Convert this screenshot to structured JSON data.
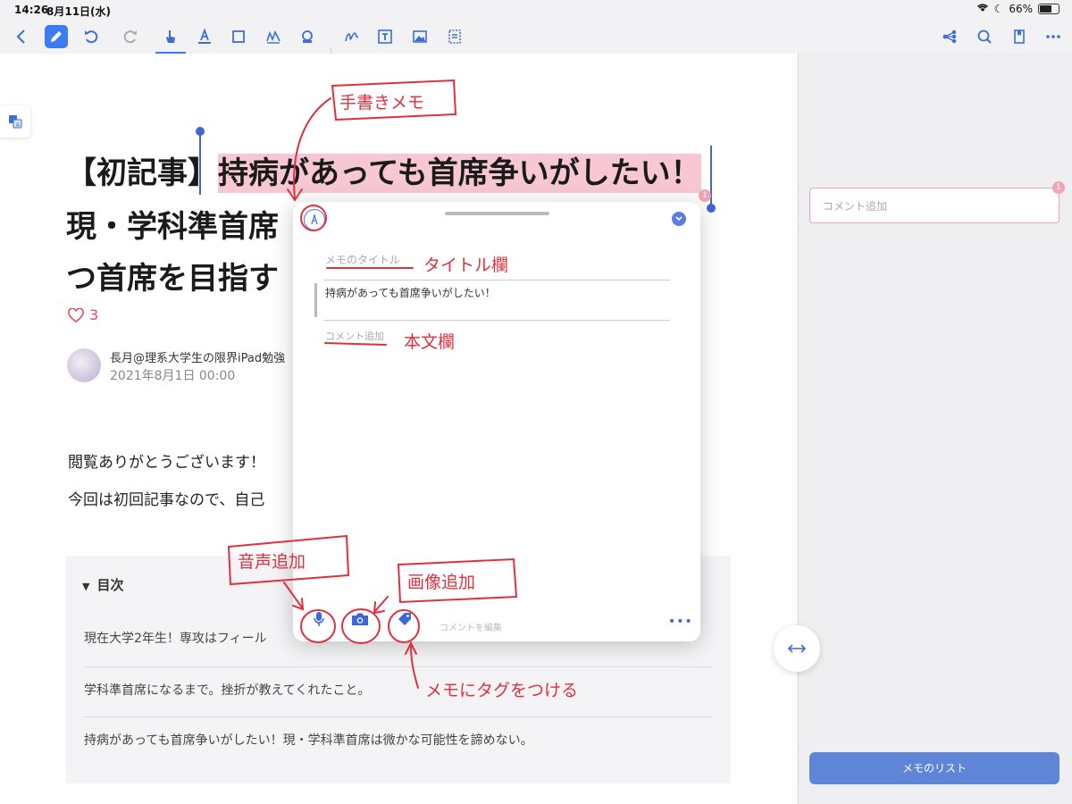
{
  "status": {
    "time": "14:26",
    "date": "8月11日(水)",
    "battery": "66%",
    "battery_level": 0.66
  },
  "toolbar": {
    "left": [
      "back-icon",
      "pen-icon",
      "undo-icon",
      "redo-icon",
      "hand-icon",
      "text-highlight-icon",
      "rect-select-icon",
      "sign-icon",
      "stamp-icon",
      "freehand-icon",
      "textbox-icon",
      "image-icon",
      "scan-icon"
    ],
    "right": [
      "share-icon",
      "search-icon",
      "bookmark-icon",
      "more-icon"
    ],
    "active": "pen-icon",
    "selected": "hand-icon"
  },
  "article": {
    "title_prefix": "【初記事】",
    "title_highlight": "持病があっても首席争いがしたい！",
    "title_line2": "現・学科準首席",
    "title_line3": "つ首席を目指す",
    "likes": "3",
    "author": "長月@理系大学生の限界iPad勉強",
    "date": "2021年8月1日 00:00",
    "para1": "閲覧ありがとうございます！",
    "para2": "今回は初回記事なので、自己"
  },
  "toc": {
    "heading": "目次",
    "items": [
      "現在大学2年生！専攻はフィール",
      "学科準首席になるまで。挫折が教えてくれたこと。",
      "持病があっても首席争いがしたい！現・学科準首席は微かな可能性を諦めない。"
    ]
  },
  "popup": {
    "memo_title_placeholder": "メモのタイトル",
    "quote": "持病があっても首席争いがしたい！",
    "comment_placeholder": "コメント追加",
    "edit_label": "コメントを編集"
  },
  "sidebar": {
    "comment_placeholder": "コメント追加",
    "badge": "1",
    "memo_list_button": "メモのリスト"
  },
  "annotations": {
    "handwritten_memo": "手書きメモ",
    "title_field": "タイトル欄",
    "body_field": "本文欄",
    "audio_add": "音声追加",
    "image_add": "画像追加",
    "tag_memo": "メモにタグをつける"
  },
  "colors": {
    "accent": "#3d7bf0",
    "highlight": "#f7c8d4",
    "annotation_red": "#e0303e",
    "memo_button": "#5f86d6"
  }
}
